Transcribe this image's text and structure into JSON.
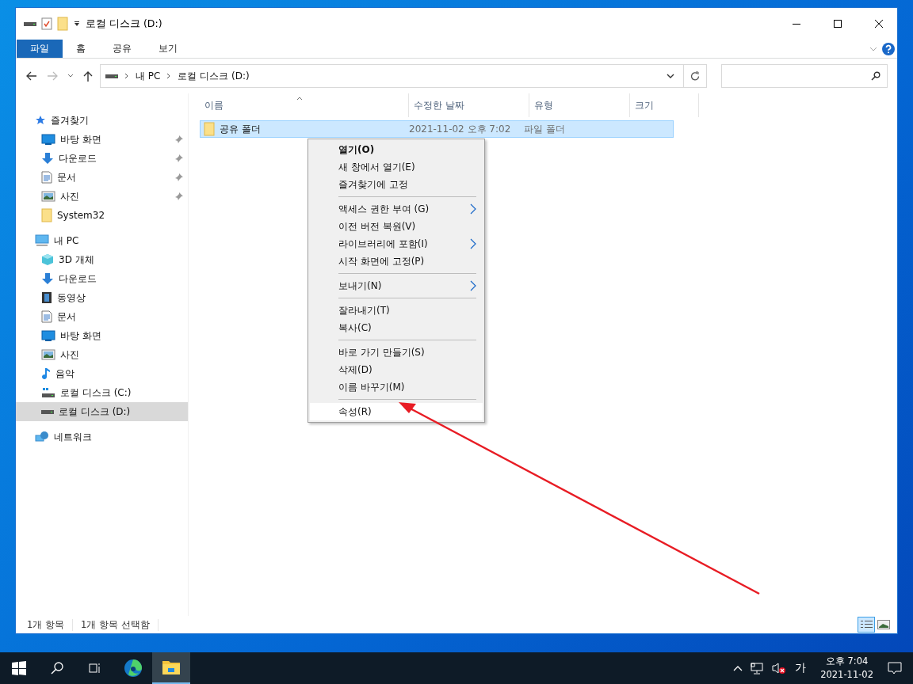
{
  "window": {
    "title": "로컬 디스크 (D:)"
  },
  "ribbon_tabs": [
    {
      "label": "파일",
      "selected": true
    },
    {
      "label": "홈",
      "selected": false
    },
    {
      "label": "공유",
      "selected": false
    },
    {
      "label": "보기",
      "selected": false
    }
  ],
  "address": {
    "crumbs": [
      "내 PC",
      "로컬 디스크 (D:)"
    ]
  },
  "sidebar": {
    "sections": [
      {
        "label": "즐겨찾기",
        "selected": false,
        "children": [
          {
            "label": "바탕 화면",
            "pinned": true,
            "selected": false
          },
          {
            "label": "다운로드",
            "pinned": true,
            "selected": false
          },
          {
            "label": "문서",
            "pinned": true,
            "selected": false
          },
          {
            "label": "사진",
            "pinned": true,
            "selected": false
          },
          {
            "label": "System32",
            "pinned": false,
            "selected": false
          }
        ]
      },
      {
        "label": "내 PC",
        "selected": false,
        "children": [
          {
            "label": "3D 개체",
            "pinned": false,
            "selected": false
          },
          {
            "label": "다운로드",
            "pinned": false,
            "selected": false
          },
          {
            "label": "동영상",
            "pinned": false,
            "selected": false
          },
          {
            "label": "문서",
            "pinned": false,
            "selected": false
          },
          {
            "label": "바탕 화면",
            "pinned": false,
            "selected": false
          },
          {
            "label": "사진",
            "pinned": false,
            "selected": false
          },
          {
            "label": "음악",
            "pinned": false,
            "selected": false
          },
          {
            "label": "로컬 디스크 (C:)",
            "pinned": false,
            "selected": false
          },
          {
            "label": "로컬 디스크 (D:)",
            "pinned": false,
            "selected": true
          }
        ]
      },
      {
        "label": "네트워크",
        "selected": false
      }
    ]
  },
  "table": {
    "columns": [
      "이름",
      "수정한 날짜",
      "유형",
      "크기"
    ],
    "rows": [
      {
        "name": "공유 폴더",
        "date": "2021-11-02 오후 7:02",
        "type": "파일 폴더",
        "selected": true
      }
    ]
  },
  "context_menu": {
    "groups": [
      [
        {
          "label": "열기(O)",
          "bold": true,
          "submenu": false,
          "selected": false
        },
        {
          "label": "새 창에서 열기(E)",
          "bold": false,
          "submenu": false,
          "selected": false
        },
        {
          "label": "즐겨찾기에 고정",
          "bold": false,
          "submenu": false,
          "selected": false
        }
      ],
      [
        {
          "label": "액세스 권한 부여 (G)",
          "bold": false,
          "submenu": true,
          "selected": false
        },
        {
          "label": "이전 버전 복원(V)",
          "bold": false,
          "submenu": false,
          "selected": false
        },
        {
          "label": "라이브러리에 포함(I)",
          "bold": false,
          "submenu": true,
          "selected": false
        },
        {
          "label": "시작 화면에 고정(P)",
          "bold": false,
          "submenu": false,
          "selected": false
        }
      ],
      [
        {
          "label": "보내기(N)",
          "bold": false,
          "submenu": true,
          "selected": false
        }
      ],
      [
        {
          "label": "잘라내기(T)",
          "bold": false,
          "submenu": false,
          "selected": false
        },
        {
          "label": "복사(C)",
          "bold": false,
          "submenu": false,
          "selected": false
        }
      ],
      [
        {
          "label": "바로 가기 만들기(S)",
          "bold": false,
          "submenu": false,
          "selected": false
        },
        {
          "label": "삭제(D)",
          "bold": false,
          "submenu": false,
          "selected": false
        },
        {
          "label": "이름 바꾸기(M)",
          "bold": false,
          "submenu": false,
          "selected": false
        }
      ],
      [
        {
          "label": "속성(R)",
          "bold": false,
          "submenu": false,
          "selected": true
        }
      ]
    ]
  },
  "status_bar": {
    "texts": [
      "1개 항목",
      "1개 항목 선택함"
    ],
    "views": [
      {
        "kind": "details",
        "selected": true
      },
      {
        "kind": "large",
        "selected": false
      }
    ]
  },
  "taskbar": {
    "apps": [
      {
        "kind": "start",
        "selected": false
      },
      {
        "kind": "search",
        "selected": false
      },
      {
        "kind": "taskview",
        "selected": false
      },
      {
        "kind": "edge",
        "selected": false
      },
      {
        "kind": "explorer",
        "selected": true
      }
    ],
    "ime": "가",
    "time": "오후 7:04",
    "date": "2021-11-02"
  }
}
